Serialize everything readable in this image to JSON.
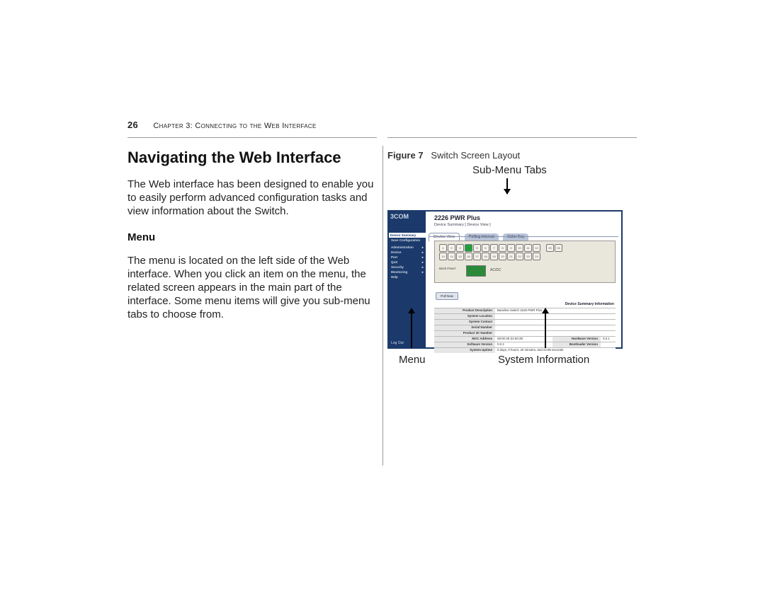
{
  "page": {
    "number": "26",
    "running_head": "Chapter 3: Connecting to the Web Interface"
  },
  "left": {
    "heading": "Navigating the Web Interface",
    "intro": "The Web interface has been designed to enable you to easily perform advanced configuration tasks and view information about the Switch.",
    "sub_heading": "Menu",
    "menu_para": "The menu is located on the left side of the Web interface. When you click an item on the menu, the related screen appears in the main part of the interface. Some menu items will give you sub-menu tabs to choose from."
  },
  "right": {
    "figure_label": "Figure 7",
    "figure_title": "Switch Screen Layout",
    "callout_top": "Sub-Menu Tabs",
    "callout_bl": "Menu",
    "callout_br": "System Information"
  },
  "shot": {
    "brand": "3COM",
    "model": "2226 PWR Plus",
    "breadcrumb": "Device Summary [ Device View ]",
    "tabs": [
      "Device View",
      "Polling Interval",
      "Color Key"
    ],
    "sidebar": [
      "Device Summary",
      "Save Configuration",
      "Administration",
      "Device",
      "Port",
      "QoS",
      "Security",
      "Monitoring",
      "Help"
    ],
    "back_panel": "Back\nPanel",
    "acdc": "AC/DC",
    "poll_btn": "Poll Now",
    "table_title": "Device Summary Information",
    "rows": [
      {
        "k": "Product Description",
        "v": "Baseline Switch 2226 PWR Plus"
      },
      {
        "k": "System Location",
        "v": ""
      },
      {
        "k": "System Contact",
        "v": ""
      },
      {
        "k": "Serial Number",
        "v": ""
      },
      {
        "k": "Product 3C Number",
        "v": ""
      },
      {
        "k": "MAC Address",
        "v": "08:00:4E:34:50:38",
        "r": "Hardware Version",
        "rv": "0.0.1"
      },
      {
        "k": "Software Version",
        "v": "0.0.2",
        "r": "Bootloader Version",
        "rv": ""
      },
      {
        "k": "System Uptime",
        "v": "0 days, 0 hours, 20 minutes, and 22.86 seconds"
      }
    ],
    "footer": "Log Out"
  }
}
